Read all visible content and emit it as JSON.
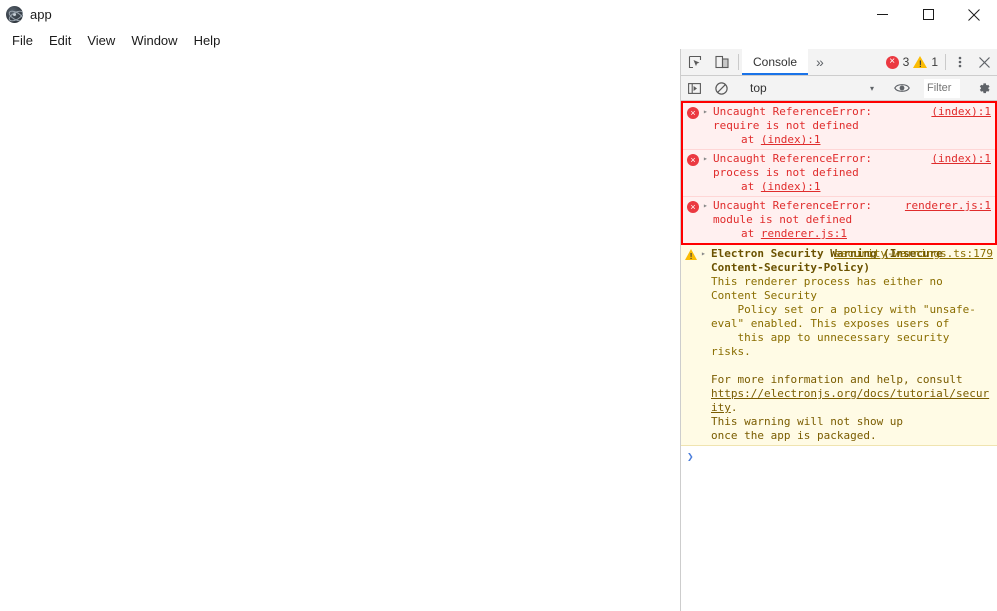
{
  "window": {
    "title": "app",
    "icon": "electron-atom-icon",
    "controls": {
      "minimize": "minimize-icon",
      "maximize": "maximize-icon",
      "close": "close-icon"
    }
  },
  "menubar": {
    "items": [
      {
        "label": "File"
      },
      {
        "label": "Edit"
      },
      {
        "label": "View"
      },
      {
        "label": "Window"
      },
      {
        "label": "Help"
      }
    ]
  },
  "devtools": {
    "toolbar": {
      "inspect_icon": "inspect-element-icon",
      "device_icon": "device-toolbar-icon",
      "tabs": [
        {
          "label": "Console",
          "active": true
        }
      ],
      "more_tabs": "»",
      "error_count": "3",
      "warning_count": "1",
      "error_badge_glyph": "×",
      "warning_badge_glyph": "!",
      "kebab_icon": "more-options-icon",
      "close_icon": "close-devtools-icon"
    },
    "filterbar": {
      "sidebar_icon": "console-sidebar-icon",
      "clear_icon": "clear-console-icon",
      "context": "top",
      "context_caret": "▾",
      "eye_icon": "live-expression-icon",
      "filter_placeholder": "Filter",
      "filter_value": "",
      "settings_icon": "settings-gear-icon"
    },
    "messages": [
      {
        "level": "error",
        "arrow": "▸",
        "title": "Uncaught ReferenceError:",
        "detail": "require is not defined",
        "stack_prefix": "    at ",
        "stack_link": "(index):1",
        "source": "(index):1"
      },
      {
        "level": "error",
        "arrow": "▸",
        "title": "Uncaught ReferenceError:",
        "detail": "process is not defined",
        "stack_prefix": "    at ",
        "stack_link": "(index):1",
        "source": "(index):1"
      },
      {
        "level": "error",
        "arrow": "▸",
        "title": "Uncaught ReferenceError:",
        "detail": "module is not defined",
        "stack_prefix": "    at ",
        "stack_link": "renderer.js:1",
        "source": "renderer.js:1"
      }
    ],
    "warning": {
      "level": "warning",
      "arrow": "▸",
      "source": "security-warnings.ts:179",
      "title": "Electron Security Warning (Insecure Content-Security-Policy)",
      "body_1": "This renderer process has either no Content Security\n    Policy set or a policy with \"unsafe-eval\" enabled. This exposes users of\n    this app to unnecessary security risks.",
      "body_2": "For more information and help, consult ",
      "link": "https://electronjs.org/docs/tutorial/security",
      "body_3": ".\nThis warning will not show up\nonce the app is packaged."
    },
    "prompt": {
      "caret": "❯",
      "value": ""
    }
  },
  "colors": {
    "error_red": "#eb3941",
    "error_text": "#e02c2c",
    "error_bg": "#fff0f0",
    "error_border": "#ff0000",
    "warn_yellow": "#fbbc04",
    "warn_bg": "#fffbe5",
    "warn_text": "#8a6d00",
    "tab_accent": "#1a73e8",
    "toolbar_bg": "#f3f3f3"
  }
}
